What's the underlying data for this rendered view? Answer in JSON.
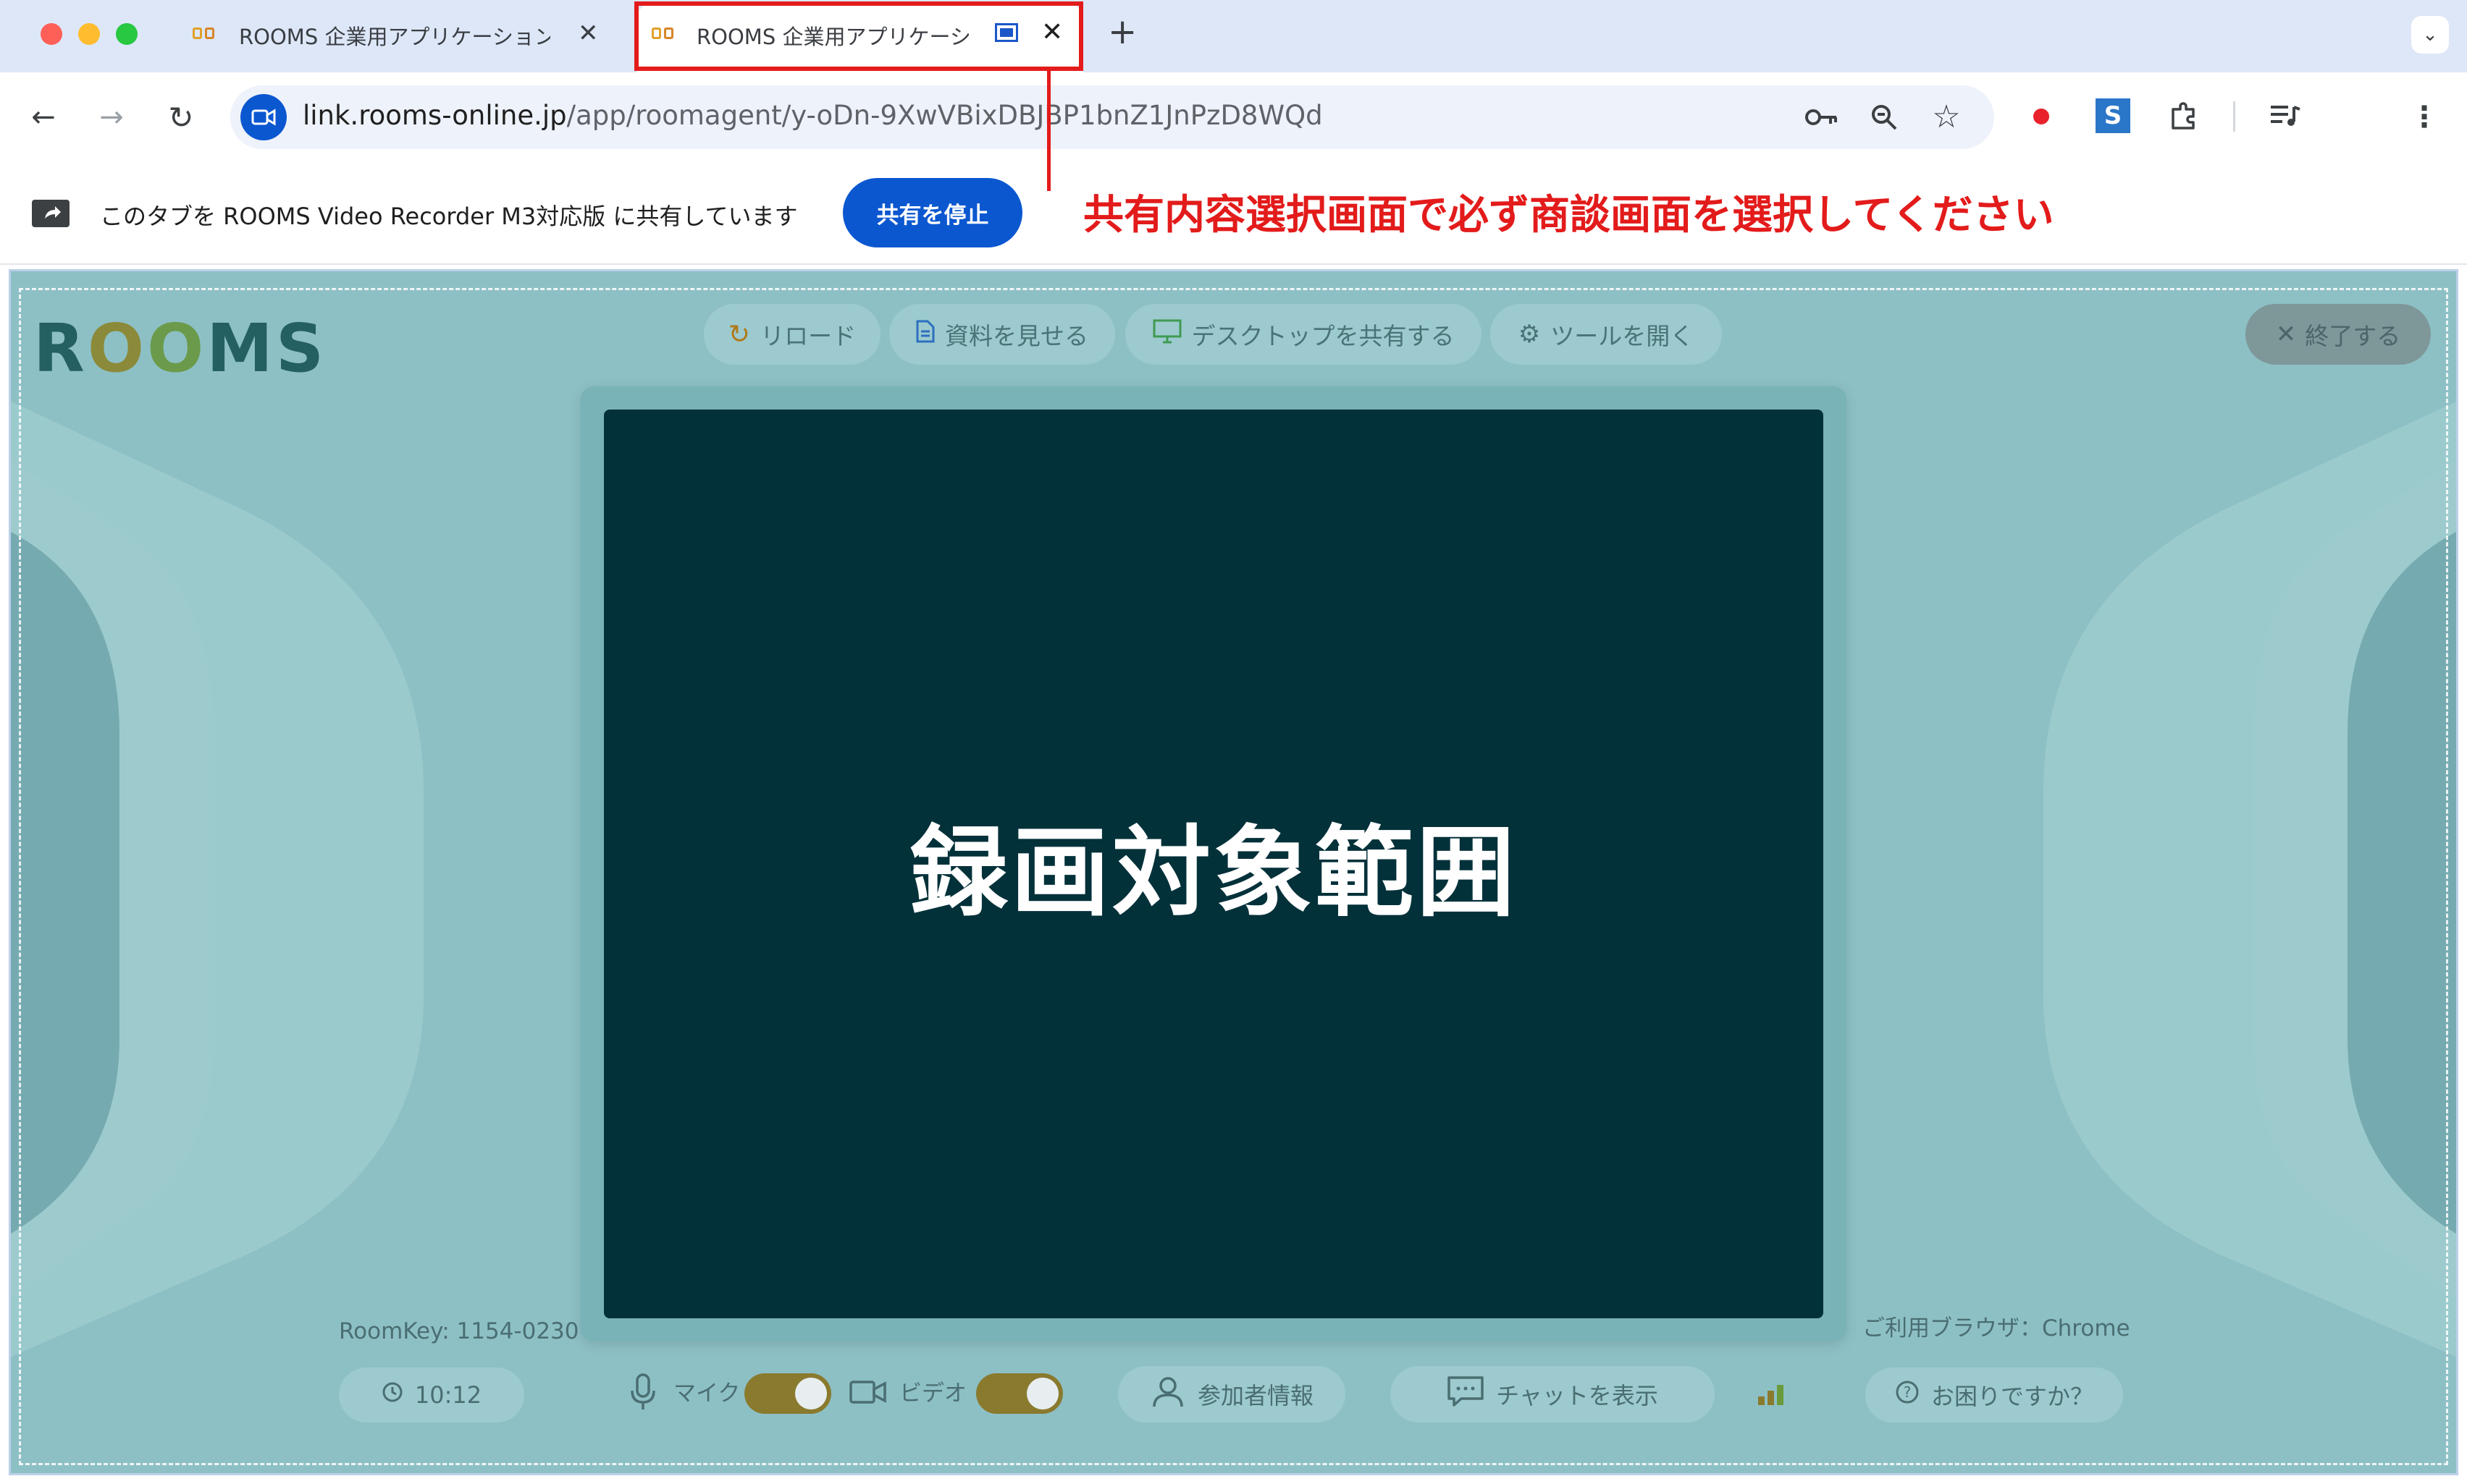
{
  "browser": {
    "tabs": [
      {
        "title": "ROOMS 企業用アプリケーション"
      },
      {
        "title": "ROOMS 企業用アプリケーシ"
      }
    ],
    "new_tab": "+",
    "url_domain": "link.rooms-online.jp",
    "url_path": "/app/roomagent/y-oDn-9XwVBixDBJBP1bnZ1JnPzD8WQd"
  },
  "infobar": {
    "share_message": "このタブを ROOMS Video Recorder M3対応版 に共有しています",
    "stop_label": "共有を停止"
  },
  "annotation": {
    "text": "共有内容選択画面で必ず商談画面を選択してください",
    "color": "#e31b1b"
  },
  "app": {
    "logo": {
      "r": "R",
      "o1": "O",
      "o2": "O",
      "ms": "MS"
    },
    "top_buttons": {
      "reload": "リロード",
      "show_docs": "資料を見せる",
      "share_desktop": "デスクトップを共有する",
      "open_tools": "ツールを開く",
      "end": "終了する"
    },
    "stage_label": "録画対象範囲",
    "room_key": "RoomKey: 1154-0230",
    "browser_info": "ご利用ブラウザ：Chrome",
    "timer": "10:12",
    "mic_label": "マイク",
    "video_label": "ビデオ",
    "participants": "参加者情報",
    "chat": "チャットを表示",
    "help": "お困りですか？",
    "colors": {
      "background": "#8dc0c5",
      "stage": "#03313a",
      "accent": "#8a7a2e"
    }
  }
}
